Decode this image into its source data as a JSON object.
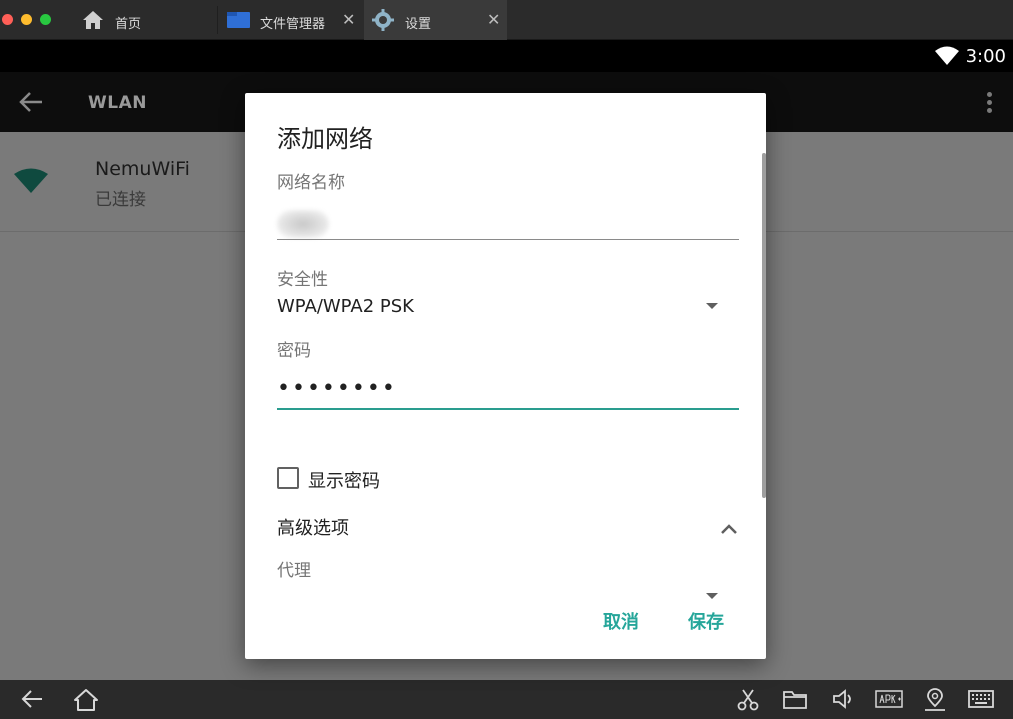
{
  "tabs": [
    {
      "label": "首页",
      "icon": "home-icon",
      "active": false
    },
    {
      "label": "文件管理器",
      "icon": "folder-icon",
      "active": false,
      "close": "✕"
    },
    {
      "label": "设置",
      "icon": "gear-icon",
      "active": true,
      "close": "✕"
    }
  ],
  "statusbar": {
    "time": "3:00"
  },
  "appbar": {
    "title": "WLAN"
  },
  "network": {
    "name": "NemuWiFi",
    "status": "已连接"
  },
  "dialog": {
    "title": "添加网络",
    "ssid_label": "网络名称",
    "security_label": "安全性",
    "security_value": "WPA/WPA2 PSK",
    "password_label": "密码",
    "password_value": "••••••••",
    "show_password_label": "显示密码",
    "advanced_label": "高级选项",
    "proxy_label": "代理",
    "cancel": "取消",
    "save": "保存"
  },
  "colors": {
    "accent": "#26a69a",
    "wifi": "#1b6b5a"
  }
}
